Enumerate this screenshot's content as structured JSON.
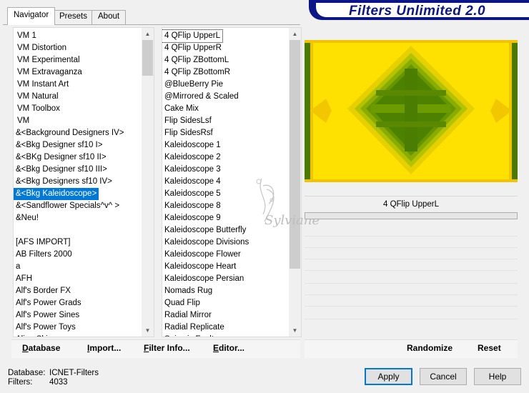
{
  "app": {
    "title": "Filters Unlimited 2.0"
  },
  "tabs": [
    {
      "label": "Navigator",
      "active": true
    },
    {
      "label": "Presets",
      "active": false
    },
    {
      "label": "About",
      "active": false
    }
  ],
  "categories": [
    {
      "label": "VM 1"
    },
    {
      "label": "VM Distortion"
    },
    {
      "label": "VM Experimental"
    },
    {
      "label": "VM Extravaganza"
    },
    {
      "label": "VM Instant Art"
    },
    {
      "label": "VM Natural"
    },
    {
      "label": "VM Toolbox"
    },
    {
      "label": "VM"
    },
    {
      "label": "&<Background Designers IV>"
    },
    {
      "label": "&<Bkg Designer sf10 I>"
    },
    {
      "label": "&<BKg Designer sf10 II>"
    },
    {
      "label": "&<Bkg Designer sf10 III>"
    },
    {
      "label": "&<Bkg Designers sf10 IV>"
    },
    {
      "label": "&<Bkg Kaleidoscope>",
      "selected": true
    },
    {
      "label": "&<Sandflower Specials^v^ >"
    },
    {
      "label": "&Neu!"
    },
    {
      "label": ""
    },
    {
      "label": "[AFS IMPORT]"
    },
    {
      "label": "AB Filters 2000"
    },
    {
      "label": "a"
    },
    {
      "label": "AFH"
    },
    {
      "label": "Alf's Border FX"
    },
    {
      "label": "Alf's Power Grads"
    },
    {
      "label": "Alf's Power Sines"
    },
    {
      "label": "Alf's Power Toys"
    },
    {
      "label": "Alien Skin"
    }
  ],
  "filters": [
    {
      "label": "4 QFlip UpperL",
      "current": true
    },
    {
      "label": "4 QFlip UpperR"
    },
    {
      "label": "4 QFlip ZBottomL"
    },
    {
      "label": "4 QFlip ZBottomR"
    },
    {
      "label": "@BlueBerry Pie"
    },
    {
      "label": "@Mirrored & Scaled"
    },
    {
      "label": "Cake Mix"
    },
    {
      "label": "Flip SidesLsf"
    },
    {
      "label": "Flip SidesRsf"
    },
    {
      "label": "Kaleidoscope 1"
    },
    {
      "label": "Kaleidoscope 2"
    },
    {
      "label": "Kaleidoscope 3"
    },
    {
      "label": "Kaleidoscope 4"
    },
    {
      "label": "Kaleidoscope 5"
    },
    {
      "label": "Kaleidoscope 8"
    },
    {
      "label": "Kaleidoscope 9"
    },
    {
      "label": "Kaleidoscope Butterfly"
    },
    {
      "label": "Kaleidoscope Divisions"
    },
    {
      "label": "Kaleidoscope Flower"
    },
    {
      "label": "Kaleidoscope Heart"
    },
    {
      "label": "Kaleidoscope Persian"
    },
    {
      "label": "Nomads Rug"
    },
    {
      "label": "Quad Flip"
    },
    {
      "label": "Radial Mirror"
    },
    {
      "label": "Radial Replicate"
    },
    {
      "label": "Seismic Fault"
    }
  ],
  "preview": {
    "filter_name": "4 QFlip UpperL",
    "watermark": "Sylviane",
    "colors": {
      "yellow": "#ffe000",
      "green": "#5d8c00",
      "dark_green": "#3e6a00"
    }
  },
  "left_buttons": {
    "database": {
      "label": "Database",
      "underline": "D"
    },
    "import": {
      "label": "Import...",
      "underline": "I"
    },
    "filter_info": {
      "label": "Filter Info...",
      "underline": "F"
    },
    "editor": {
      "label": "Editor...",
      "underline": "E"
    }
  },
  "right_buttons": {
    "randomize": "Randomize",
    "reset": "Reset"
  },
  "status": {
    "database_label": "Database:",
    "database_value": "ICNET-Filters",
    "filters_label": "Filters:",
    "filters_value": "4033"
  },
  "dialog_buttons": {
    "apply": "Apply",
    "cancel": "Cancel",
    "help": "Help"
  },
  "colors": {
    "selection": "#0078d7",
    "banner_blue": "#0b1588"
  },
  "icons": [
    "scroll-up-arrow-icon",
    "scroll-down-arrow-icon"
  ]
}
